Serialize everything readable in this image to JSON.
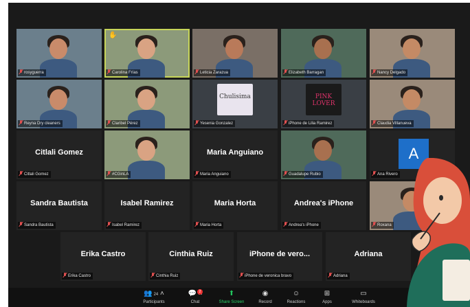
{
  "tiles": [
    {
      "name": "rosyguerra",
      "video": true
    },
    {
      "name": "Carolina Frías",
      "video": true,
      "hand": true,
      "active": true
    },
    {
      "name": "Leticia Zarazua",
      "video": true
    },
    {
      "name": "Elizabeth Barragan",
      "video": true
    },
    {
      "name": "Nancy Delgado",
      "video": true
    },
    {
      "name": "Reyna Dry cleaners",
      "video": true
    },
    {
      "name": "Claribel Pérez",
      "video": true
    },
    {
      "name": "Yesenia Gonzalez",
      "video": true,
      "image_text": "Chulisima"
    },
    {
      "name": "iPhone de Lilia Ramirez",
      "video": true,
      "image_text": "PINK LOVER"
    },
    {
      "name": "Claudia Villanueva",
      "video": true
    },
    {
      "name": "Citlali Gomez",
      "big": "Citlali Gomez"
    },
    {
      "name": "#CGinLA",
      "video": true
    },
    {
      "name": "Maria Anguiano",
      "big": "Maria Anguiano"
    },
    {
      "name": "Guadalupe Rubio",
      "video": true
    },
    {
      "name": "Ana Rivero",
      "avatar": "A"
    },
    {
      "name": "Sandra Bautista",
      "big": "Sandra Bautista"
    },
    {
      "name": "Isabel Ramirez",
      "big": "Isabel Ramirez"
    },
    {
      "name": "Maria Horta",
      "big": "Maria Horta"
    },
    {
      "name": "Andrea's iPhone",
      "big": "Andrea's iPhone"
    },
    {
      "name": "Roxana",
      "video": true
    },
    {
      "name": "Erika Castro",
      "big": "Erika Castro"
    },
    {
      "name": "Cinthia Ruiz",
      "big": "Cinthia Ruiz"
    },
    {
      "name": "iPhone de veronica bravo",
      "big": "iPhone de vero..."
    },
    {
      "name": "Adriana",
      "big": "Adriana"
    }
  ],
  "toolbar": {
    "participants_label": "Participants",
    "participants_count": "24",
    "chat_label": "Chat",
    "chat_badge": "2",
    "share_label": "Share Screen",
    "record_label": "Record",
    "reactions_label": "Reactions",
    "apps_label": "Apps",
    "whiteboards_label": "Whiteboards"
  },
  "colors": {
    "active_speaker": "#c8d65a",
    "share_green": "#22c55e",
    "muted_red": "#e05050"
  }
}
